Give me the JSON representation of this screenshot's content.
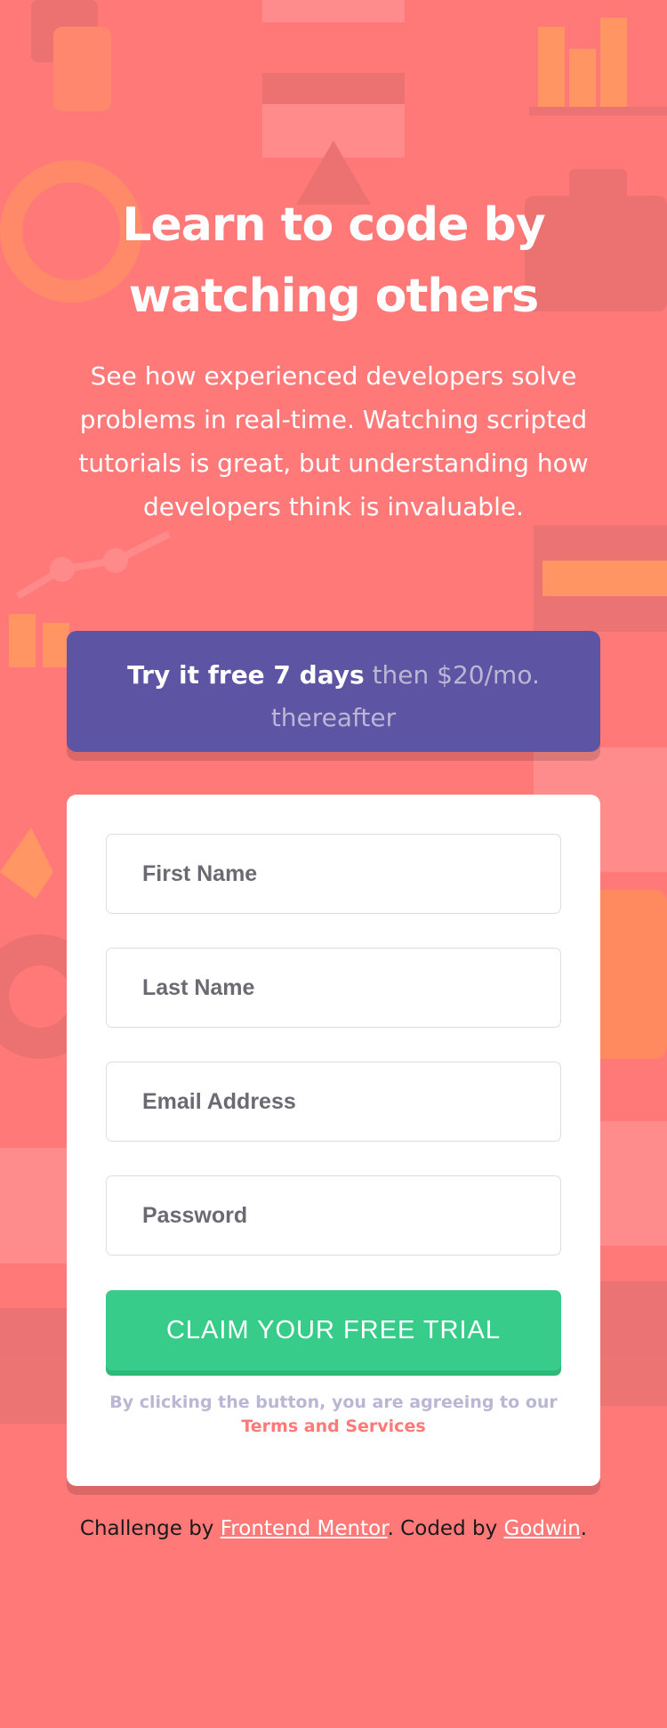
{
  "colors": {
    "background": "#ff7979",
    "offer_bg": "#5e54a4",
    "cta_bg": "#38cc8b",
    "terms_link": "#ff7979",
    "muted_text": "#bab7d4"
  },
  "hero": {
    "title": "Learn to code by watching others",
    "description": "See how experienced developers solve problems in real-time. Watching scripted tutorials is great, but understanding how developers think is invaluable."
  },
  "offer": {
    "strong_text": "Try it free 7 days",
    "rest_text": "then $20/mo. thereafter"
  },
  "form": {
    "first_name_placeholder": "First Name",
    "last_name_placeholder": "Last Name",
    "email_placeholder": "Email Address",
    "password_placeholder": "Password",
    "submit_label": "CLAIM YOUR FREE TRIAL",
    "terms_prefix": "By clicking the button, you are agreeing to our",
    "terms_link_text": "Terms and Services"
  },
  "footer": {
    "prefix": "Challenge by",
    "link1_text": "Frontend Mentor",
    "middle": ". Coded by",
    "link2_text": "Godwin",
    "suffix": "."
  }
}
